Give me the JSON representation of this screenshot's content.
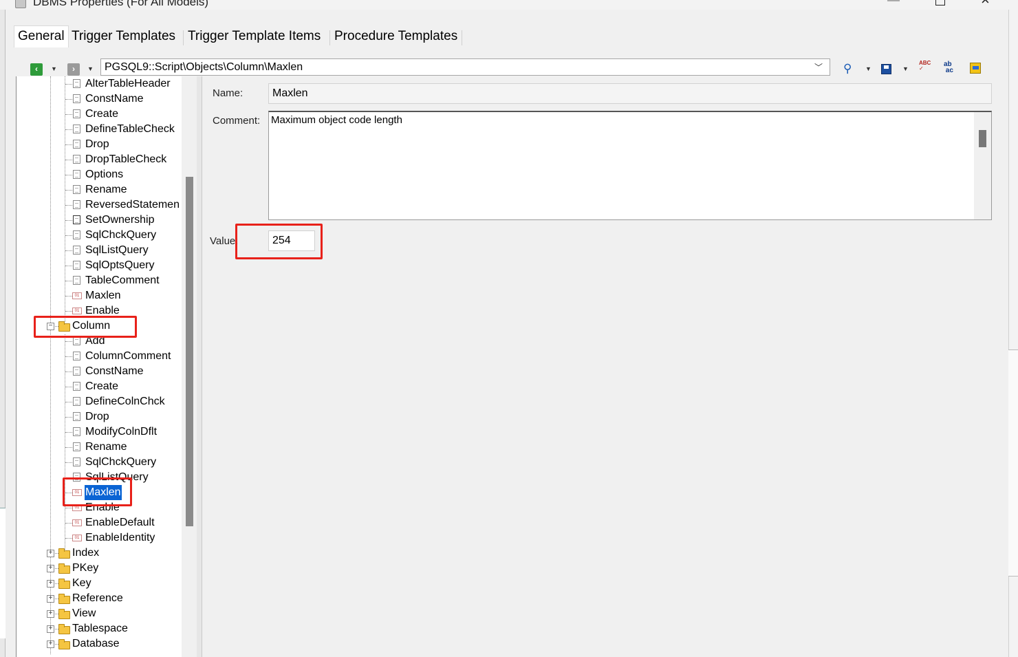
{
  "window": {
    "title": "DBMS Properties (For All Models)"
  },
  "tabs": [
    {
      "label": "General",
      "active": true
    },
    {
      "label": "Trigger Templates",
      "active": false
    },
    {
      "label": "Trigger Template Items",
      "active": false
    },
    {
      "label": "Procedure Templates",
      "active": false
    }
  ],
  "toolbar": {
    "path": "PGSQL9::Script\\Objects\\Column\\Maxlen",
    "icons": [
      "back-icon",
      "forward-icon",
      "find-icon",
      "save-icon",
      "spell-check-icon",
      "replace-icon",
      "properties-icon"
    ]
  },
  "tree": {
    "table_children": [
      {
        "label": "AlterTableHeader",
        "icon": "doc"
      },
      {
        "label": "ConstName",
        "icon": "doc"
      },
      {
        "label": "Create",
        "icon": "doc"
      },
      {
        "label": "DefineTableCheck",
        "icon": "doc"
      },
      {
        "label": "Drop",
        "icon": "doc"
      },
      {
        "label": "DropTableCheck",
        "icon": "doc"
      },
      {
        "label": "Options",
        "icon": "doc"
      },
      {
        "label": "Rename",
        "icon": "doc"
      },
      {
        "label": "ReversedStatemen",
        "icon": "doc"
      },
      {
        "label": "SetOwnership",
        "icon": "doc-dark"
      },
      {
        "label": "SqlChckQuery",
        "icon": "doc"
      },
      {
        "label": "SqlListQuery",
        "icon": "doc"
      },
      {
        "label": "SqlOptsQuery",
        "icon": "doc"
      },
      {
        "label": "TableComment",
        "icon": "doc"
      },
      {
        "label": "Maxlen",
        "icon": "value"
      },
      {
        "label": "Enable",
        "icon": "value"
      }
    ],
    "column_folder": {
      "label": "Column",
      "expanded": true
    },
    "column_children": [
      {
        "label": "Add",
        "icon": "doc"
      },
      {
        "label": "ColumnComment",
        "icon": "doc"
      },
      {
        "label": "ConstName",
        "icon": "doc"
      },
      {
        "label": "Create",
        "icon": "doc"
      },
      {
        "label": "DefineColnChck",
        "icon": "doc"
      },
      {
        "label": "Drop",
        "icon": "doc"
      },
      {
        "label": "ModifyColnDflt",
        "icon": "doc"
      },
      {
        "label": "Rename",
        "icon": "doc"
      },
      {
        "label": "SqlChckQuery",
        "icon": "doc"
      },
      {
        "label": "SqlListQuery",
        "icon": "doc"
      },
      {
        "label": "Maxlen",
        "icon": "value",
        "selected": true
      },
      {
        "label": "Enable",
        "icon": "value"
      },
      {
        "label": "EnableDefault",
        "icon": "value"
      },
      {
        "label": "EnableIdentity",
        "icon": "value"
      }
    ],
    "folders": [
      {
        "label": "Index"
      },
      {
        "label": "PKey"
      },
      {
        "label": "Key"
      },
      {
        "label": "Reference"
      },
      {
        "label": "View"
      },
      {
        "label": "Tablespace"
      },
      {
        "label": "Database"
      }
    ]
  },
  "detail": {
    "name_label": "Name:",
    "name_value": "Maxlen",
    "comment_label": "Comment:",
    "comment_value": "Maximum object code length",
    "value_label": "Value:",
    "value_value": "254"
  },
  "colors": {
    "selection": "#0a64d4",
    "callout": "#e8211a",
    "folder": "#f5c542"
  }
}
